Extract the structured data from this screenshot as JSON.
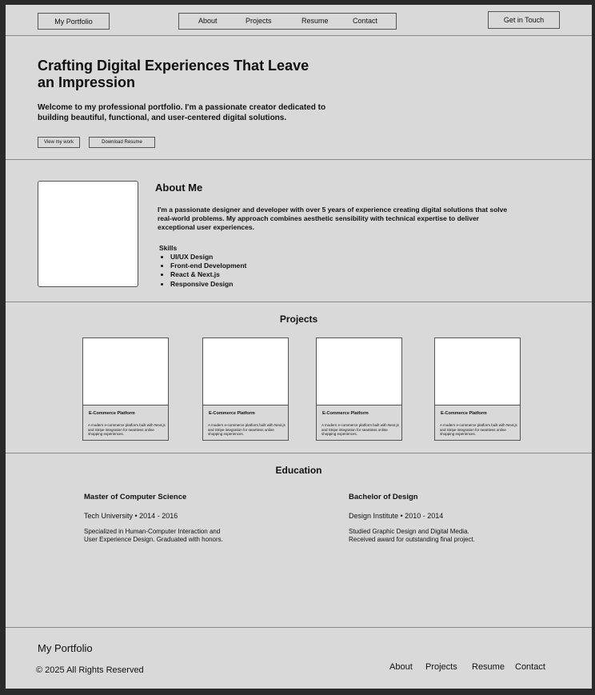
{
  "header": {
    "brand": "My Portfolio",
    "nav": [
      "About",
      "Projects",
      "Resume",
      "Contact"
    ],
    "cta": "Get in Touch"
  },
  "hero": {
    "title": "Crafting Digital Experiences That Leave an Impression",
    "subtitle": "Welcome to my professional portfolio. I'm a passionate creator dedicated to building beautiful, functional, and user-centered digital solutions.",
    "btn_primary": "View my work",
    "btn_secondary": "Download Resume"
  },
  "about": {
    "title": "About Me",
    "text": "I'm a passionate designer and developer with over 5 years of experience creating digital solutions that solve real-world problems. My approach combines aesthetic sensibility with technical expertise to deliver exceptional user experiences.",
    "skills_label": "Skills",
    "skills": [
      "UI/UX Design",
      "Front-end Development",
      "React & Next.js",
      "Responsive Design"
    ]
  },
  "projects": {
    "title": "Projects",
    "items": [
      {
        "title": "E-Commerce Platform",
        "desc": "A modern e-commerce platform built with Next.js and Stripe integration for seamless online shopping experiences."
      },
      {
        "title": "E-Commerce Platform",
        "desc": "A modern e-commerce platform built with Next.js and Stripe integration for seamless online shopping experiences."
      },
      {
        "title": "E-Commerce Platform",
        "desc": "A modern e-commerce platform built with Next.js and Stripe integration for seamless online shopping experiences."
      },
      {
        "title": "E-Commerce Platform",
        "desc": "A modern e-commerce platform built with Next.js and Stripe integration for seamless online shopping experiences."
      }
    ]
  },
  "education": {
    "title": "Education",
    "items": [
      {
        "degree": "Master of Computer Science",
        "school": "Tech University • 2014 - 2016",
        "desc": "Specialized in Human-Computer Interaction and User Experience Design. Graduated with honors."
      },
      {
        "degree": "Bachelor of Design",
        "school": "Design Institute • 2010 - 2014",
        "desc": "Studied Graphic Design and Digital Media. Received award for outstanding final project."
      }
    ]
  },
  "footer": {
    "brand": "My Portfolio",
    "copyright": "© 2025 All Rights Reserved",
    "links": [
      "About",
      "Projects",
      "Resume",
      "Contact"
    ]
  }
}
